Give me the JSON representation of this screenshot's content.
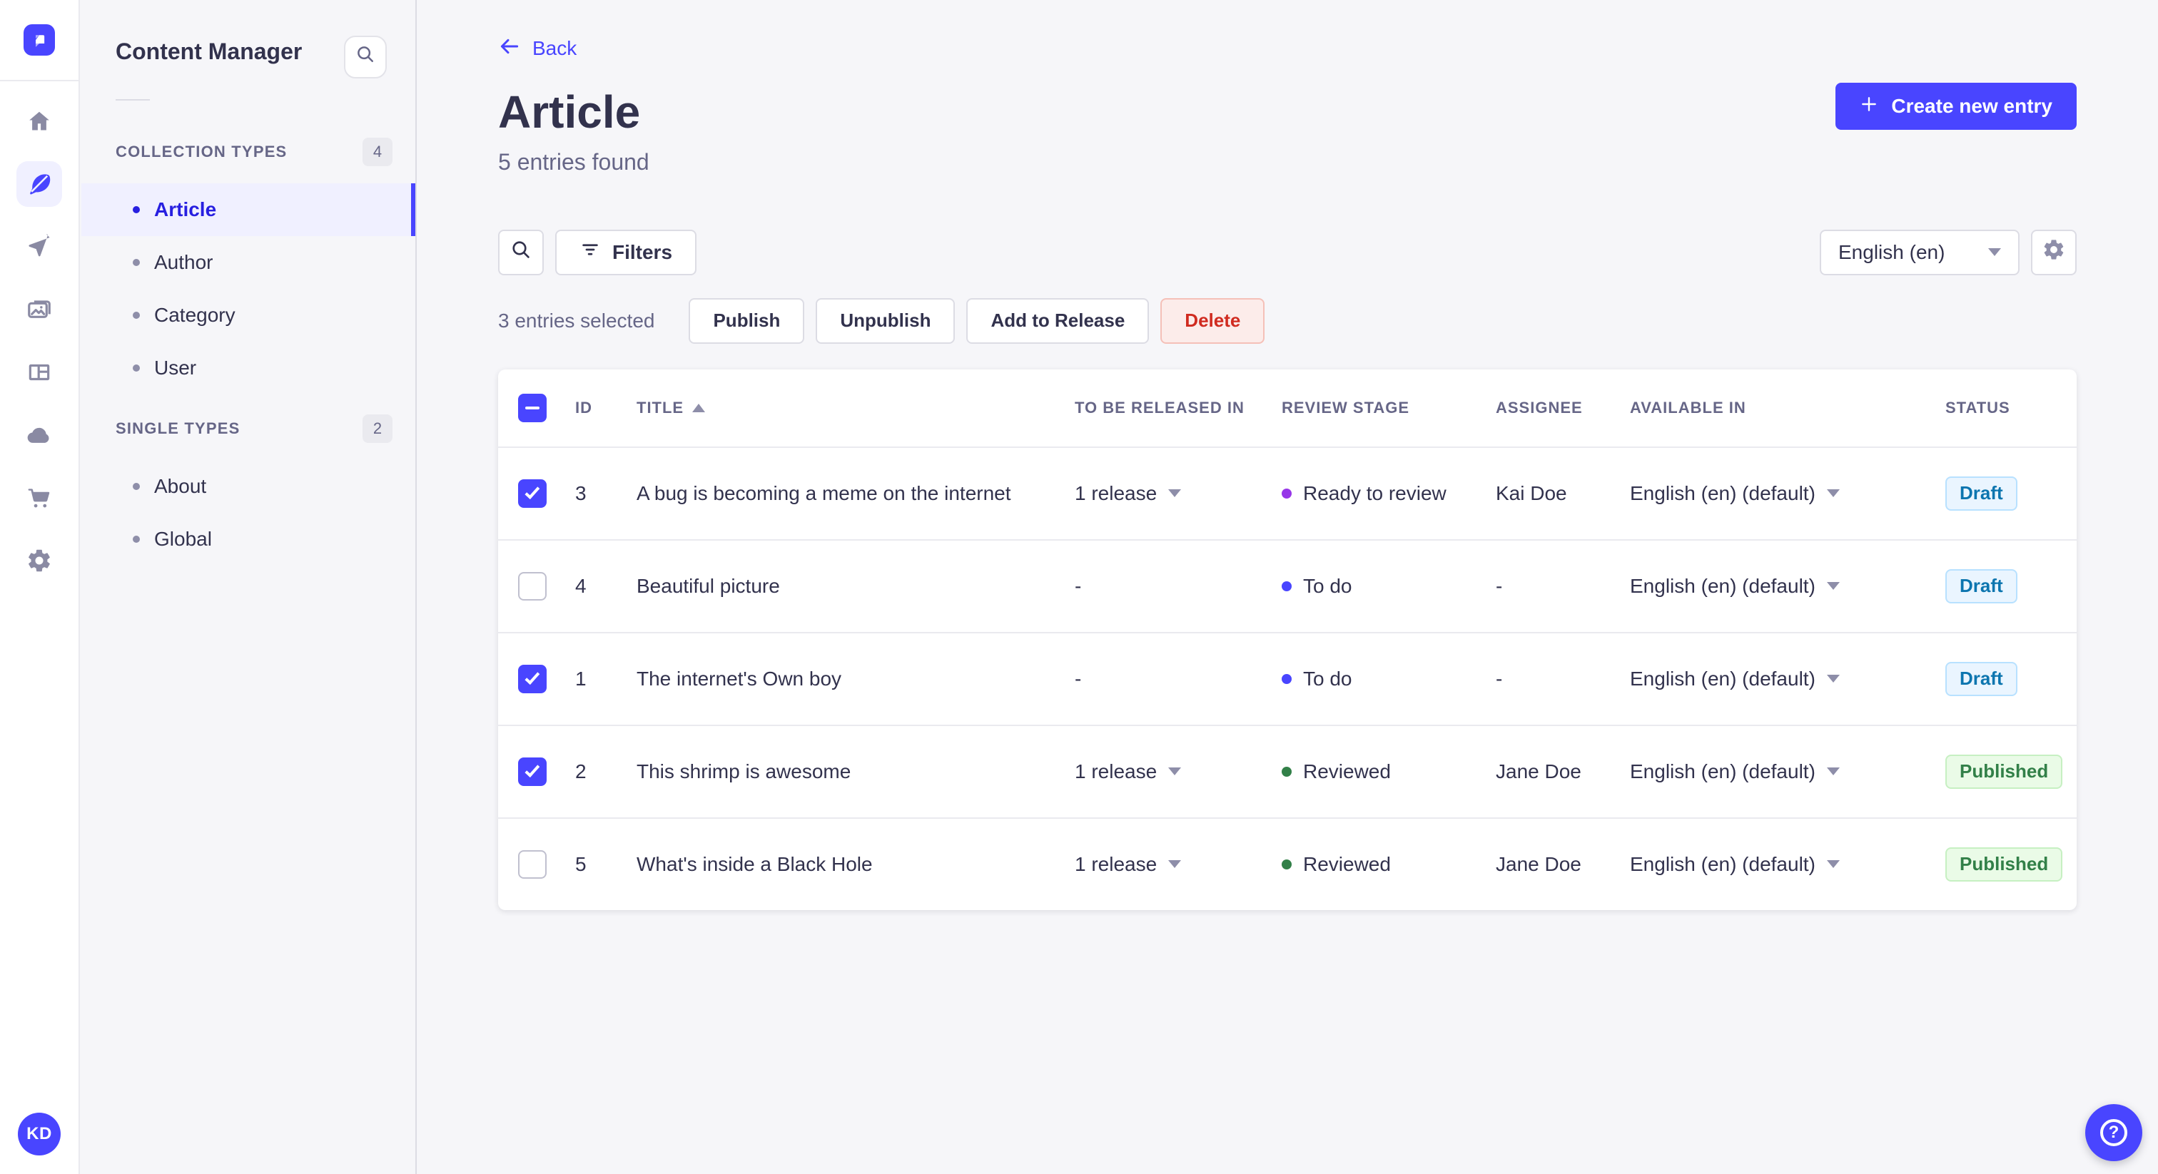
{
  "colors": {
    "accent": "#4945FF",
    "active_link_text": "#271FE0",
    "draft_text": "#0C75AF",
    "draft_bg": "#EAF5FF",
    "published_text": "#328048",
    "published_bg": "#EAFBE7",
    "danger_text": "#D02B20",
    "stage_ready_to_review": "#9736E8",
    "stage_to_do": "#4945FF",
    "stage_reviewed": "#328048"
  },
  "rail": {
    "logo_icon": "strapi-logo",
    "avatar_initials": "KD",
    "icons": [
      {
        "icon": "home",
        "active": false
      },
      {
        "icon": "content-manager",
        "active": true
      },
      {
        "icon": "releases",
        "active": false
      },
      {
        "icon": "media-library",
        "active": false
      },
      {
        "icon": "content-type-builder",
        "active": false
      },
      {
        "icon": "deploy-cloud",
        "active": false
      },
      {
        "icon": "marketplace-cart",
        "active": false
      },
      {
        "icon": "settings-gear",
        "active": false
      }
    ]
  },
  "subnav": {
    "title": "Content Manager",
    "search_icon": "search-icon",
    "sections": [
      {
        "label": "COLLECTION TYPES",
        "count": "4",
        "items": [
          {
            "label": "Article",
            "active": true
          },
          {
            "label": "Author",
            "active": false
          },
          {
            "label": "Category",
            "active": false
          },
          {
            "label": "User",
            "active": false
          }
        ]
      },
      {
        "label": "SINGLE TYPES",
        "count": "2",
        "items": [
          {
            "label": "About",
            "active": false
          },
          {
            "label": "Global",
            "active": false
          }
        ]
      }
    ]
  },
  "header": {
    "back": "Back",
    "title": "Article",
    "subtitle": "5 entries found",
    "create": "Create new entry"
  },
  "toolbar": {
    "filters": "Filters",
    "locale": "English (en)"
  },
  "selection": {
    "summary": "3 entries selected",
    "actions": [
      {
        "label": "Publish"
      },
      {
        "label": "Unpublish"
      },
      {
        "label": "Add to Release"
      },
      {
        "label": "Delete"
      }
    ]
  },
  "table": {
    "headers": {
      "id": "ID",
      "title": "TITLE",
      "release": "TO BE RELEASED IN",
      "stage": "REVIEW STAGE",
      "assignee": "ASSIGNEE",
      "available": "AVAILABLE IN",
      "status": "STATUS"
    },
    "sorted_by": "TITLE",
    "sort_direction": "ascending",
    "rows": [
      {
        "checked": true,
        "id": "3",
        "title": "A bug is becoming a meme on the internet",
        "release": "1 release",
        "release_menu": true,
        "stage": "Ready to review",
        "stage_color": "#9736E8",
        "assignee": "Kai Doe",
        "available": "English (en) (default)",
        "status": "Draft"
      },
      {
        "checked": false,
        "id": "4",
        "title": "Beautiful picture",
        "release": "-",
        "release_menu": false,
        "stage": "To do",
        "stage_color": "#4945FF",
        "assignee": "-",
        "available": "English (en) (default)",
        "status": "Draft"
      },
      {
        "checked": true,
        "id": "1",
        "title": "The internet's Own boy",
        "release": "-",
        "release_menu": false,
        "stage": "To do",
        "stage_color": "#4945FF",
        "assignee": "-",
        "available": "English (en) (default)",
        "status": "Draft"
      },
      {
        "checked": true,
        "id": "2",
        "title": "This shrimp is awesome",
        "release": "1 release",
        "release_menu": true,
        "stage": "Reviewed",
        "stage_color": "#328048",
        "assignee": "Jane Doe",
        "available": "English (en) (default)",
        "status": "Published"
      },
      {
        "checked": false,
        "id": "5",
        "title": "What's inside a Black Hole",
        "release": "1 release",
        "release_menu": true,
        "stage": "Reviewed",
        "stage_color": "#328048",
        "assignee": "Jane Doe",
        "available": "English (en) (default)",
        "status": "Published"
      }
    ]
  },
  "help": {
    "glyph": "?"
  }
}
